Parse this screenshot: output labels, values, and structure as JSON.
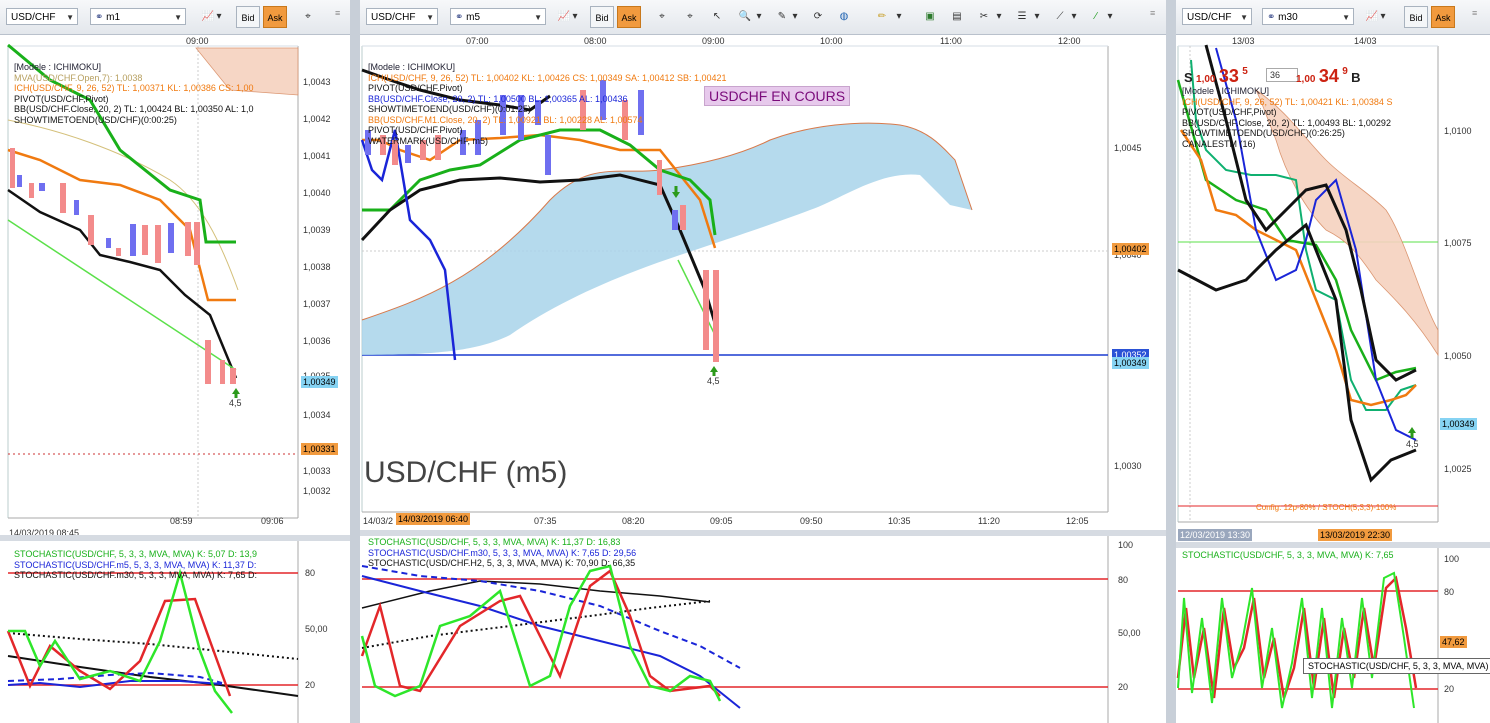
{
  "panels": {
    "left": {
      "symbol": "USD/CHF",
      "timeframe": "m1",
      "time_axis_top": [
        "09:00"
      ],
      "price_ticks": [
        "1,0043",
        "1,0042",
        "1,0041",
        "1,0040",
        "1,0039",
        "1,0038",
        "1,0037",
        "1,0036",
        "1,0035",
        "1,0034",
        "1,0033",
        "1,0032"
      ],
      "price_tag_current": "1,00349",
      "price_tag_other": "1,00331",
      "legend": [
        "[Modele : ICHIMOKU]",
        "MVA(USD/CHF.Open,7): 1,0038",
        "ICH(USD/CHF, 9, 26, 52)  TL: 1,00371  KL: 1,00386  CS: 1,00",
        "PIVOT(USD/CHF,Pivot)",
        "BB(USD/CHF.Close, 20, 2)  TL: 1,00424  BL: 1,00350  AL: 1,0",
        "SHOWTIMETOEND(USD/CHF)(0:00:25)"
      ],
      "arrow_label": "4,5",
      "time_axis_bottom": [
        "14/03/2019 08:45",
        "08:59",
        "09:06"
      ],
      "stoch_legend": [
        "STOCHASTIC(USD/CHF, 5, 3, 3, MVA, MVA)  K: 5,07  D: 13,9",
        "STOCHASTIC(USD/CHF.m5, 5, 3, 3, MVA, MVA)  K: 11,37  D:",
        "STOCHASTIC(USD/CHF.m30, 5, 3, 3, MVA, MVA)  K: 7,65  D:"
      ],
      "stoch_ticks": [
        "80",
        "50,00",
        "20"
      ]
    },
    "middle": {
      "symbol": "USD/CHF",
      "timeframe": "m5",
      "time_axis_top": [
        "07:00",
        "08:00",
        "09:00",
        "10:00",
        "11:00",
        "12:00"
      ],
      "price_ticks": [
        "1,0045",
        "1,0040",
        "1,0035",
        "1,0030"
      ],
      "price_tag_current": "1,00349",
      "price_tag_other": "1,00402",
      "price_tag_blue": "1,00352",
      "legend": [
        "[Modele : ICHIMOKU]",
        "ICH(USD/CHF, 9, 26, 52)  TL: 1,00402  KL: 1,00426  CS: 1,00349  SA: 1,00412  SB: 1,00421",
        "PIVOT(USD/CHF.Pivot)",
        "BB(USD/CHF.Close, 20, 2)  TL: 1,00500  BL: 1,00365  AL: 1,00436",
        "SHOWTIMETOEND(USD/CHF)(0:01:25)",
        "BB(USD/CHF.M1.Close, 20, 2)  TL: 1,00921  BL: 1,00228  AL: 1,00574",
        "PIVOT(USD/CHF.Pivot)",
        "WATERMARK(USD/CHF, m5)"
      ],
      "banner": "USDCHF EN COURS",
      "watermark": "USD/CHF (m5)",
      "arrow_label": "4,5",
      "date_tag": "14/03/2019 06:40",
      "date_prefix": "14/03/2",
      "time_axis_bottom": [
        "07:35",
        "08:20",
        "09:05",
        "09:50",
        "10:35",
        "11:20",
        "12:05"
      ],
      "stoch_legend": [
        "STOCHASTIC(USD/CHF, 5, 3, 3, MVA, MVA)  K: 11,37  D: 16,83",
        "STOCHASTIC(USD/CHF.m30, 5, 3, 3, MVA, MVA)  K: 7,65  D: 29,56",
        "STOCHASTIC(USD/CHF.H2, 5, 3, 3, MVA, MVA)  K: 70,90  D: 66,35"
      ],
      "stoch_ticks": [
        "100",
        "80",
        "50,00",
        "20"
      ]
    },
    "right": {
      "symbol": "USD/CHF",
      "timeframe": "m30",
      "time_axis_top": [
        "13/03",
        "14/03"
      ],
      "price_ticks": [
        "1,0100",
        "1,0075",
        "1,0050",
        "1,0025"
      ],
      "price_tag_current": "1,00349",
      "sell": {
        "label": "S",
        "big": "1,00",
        "main": "33",
        "sup": "5"
      },
      "buy": {
        "label": "B",
        "big": "1,00",
        "main": "34",
        "sup": "9"
      },
      "spread": "36",
      "legend": [
        "[Modele : ICHIMOKU]",
        "ICH(USD/CHF, 9, 26, 52)  TL: 1,00421  KL: 1,00384  S",
        "PIVOT(USD/CHF,Pivot)",
        "BB(USD/CHF.Close, 20, 2)  TL: 1,00493  BL: 1,00292",
        "SHOWTIMETOEND(USD/CHF)(0:26:25)",
        "CANALESTM (16)"
      ],
      "config_text": "Config: 12p-80% / STOCH(5,3,3)-100%",
      "arrow_label": "4,5",
      "date_tag_left": "12/03/2019 13:30",
      "date_tag_right": "13/03/2019 22:30",
      "stoch_legend": [
        "STOCHASTIC(USD/CHF, 5, 3, 3, MVA, MVA)  K: 7,65"
      ],
      "stoch_ticks": [
        "100",
        "80",
        "47,62",
        "20"
      ],
      "tooltip": "STOCHASTIC(USD/CHF, 5, 3, 3, MVA, MVA)"
    }
  },
  "toolbar": {
    "bid_label": "Bid",
    "ask_label": "Ask"
  },
  "colors": {
    "ask": "#f19a3e",
    "cloud": "#a8d4ea",
    "bull_candle": "#6f6ff0",
    "bear_candle": "#f38b8b",
    "green": "#19b01a",
    "orange": "#f07a10",
    "blue": "#1a25d8",
    "red": "#e3272a"
  }
}
